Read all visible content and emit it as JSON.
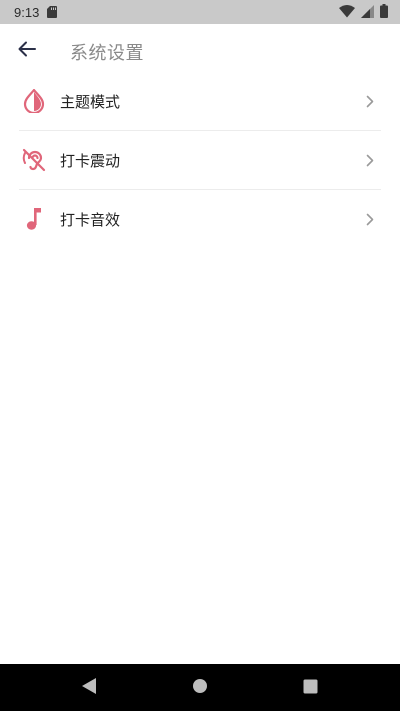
{
  "status_bar": {
    "time": "9:13",
    "icons": [
      "sd-card-icon",
      "wifi-icon",
      "signal-icon",
      "battery-icon"
    ]
  },
  "header": {
    "title": "系统设置",
    "back_icon": "arrow-left-icon"
  },
  "settings": {
    "items": [
      {
        "label": "主题模式",
        "icon": "water-drop-icon"
      },
      {
        "label": "打卡震动",
        "icon": "hearing-disabled-icon"
      },
      {
        "label": "打卡音效",
        "icon": "music-note-icon"
      }
    ]
  },
  "nav_bar": {
    "buttons": [
      "back-triangle-icon",
      "home-circle-icon",
      "recents-square-icon"
    ]
  },
  "colors": {
    "accent": "#e0667a",
    "status_bar": "#c9c9c9",
    "title_text": "#8a8a8a",
    "divider": "#ececec"
  }
}
